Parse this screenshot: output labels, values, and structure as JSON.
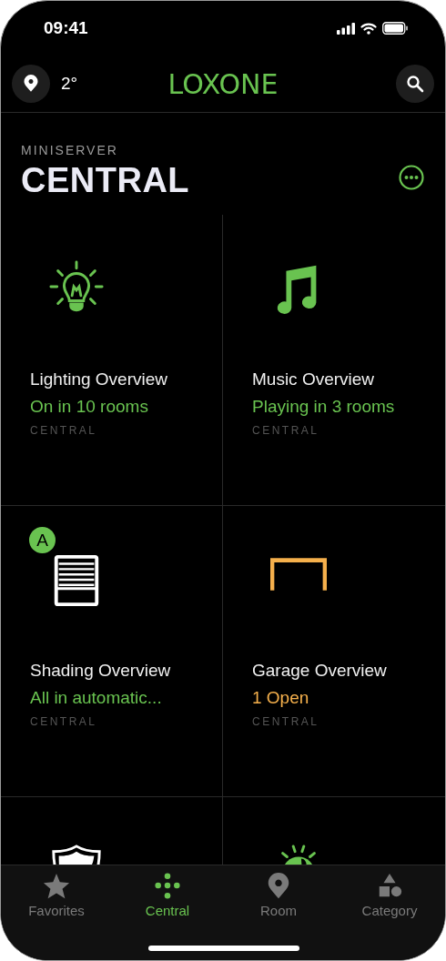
{
  "status_bar": {
    "time": "09:41"
  },
  "header": {
    "temperature": "2°",
    "logo": "LOXONE"
  },
  "section": {
    "overline": "MINISERVER",
    "title": "CENTRAL"
  },
  "cards": [
    {
      "kind": "bulb",
      "title": "Lighting Overview",
      "status": "On in 10 rooms",
      "color": "#69c350",
      "location": "CENTRAL"
    },
    {
      "kind": "note",
      "title": "Music Overview",
      "status": "Playing in 3 rooms",
      "color": "#69c350",
      "location": "CENTRAL"
    },
    {
      "kind": "blinds",
      "badge": "A",
      "title": "Shading Overview",
      "status": "All in automatic...",
      "color": "#69c350",
      "location": "CENTRAL"
    },
    {
      "kind": "garage",
      "title": "Garage Overview",
      "status": "1 Open",
      "color": "#f5b04c",
      "location": "CENTRAL"
    },
    {
      "kind": "shield"
    },
    {
      "kind": "siren"
    }
  ],
  "tabs": [
    {
      "kind": "star",
      "label": "Favorites",
      "selected": false
    },
    {
      "kind": "dots",
      "label": "Central",
      "selected": true
    },
    {
      "kind": "pin",
      "label": "Room",
      "selected": false
    },
    {
      "kind": "shapes",
      "label": "Category",
      "selected": false
    }
  ]
}
